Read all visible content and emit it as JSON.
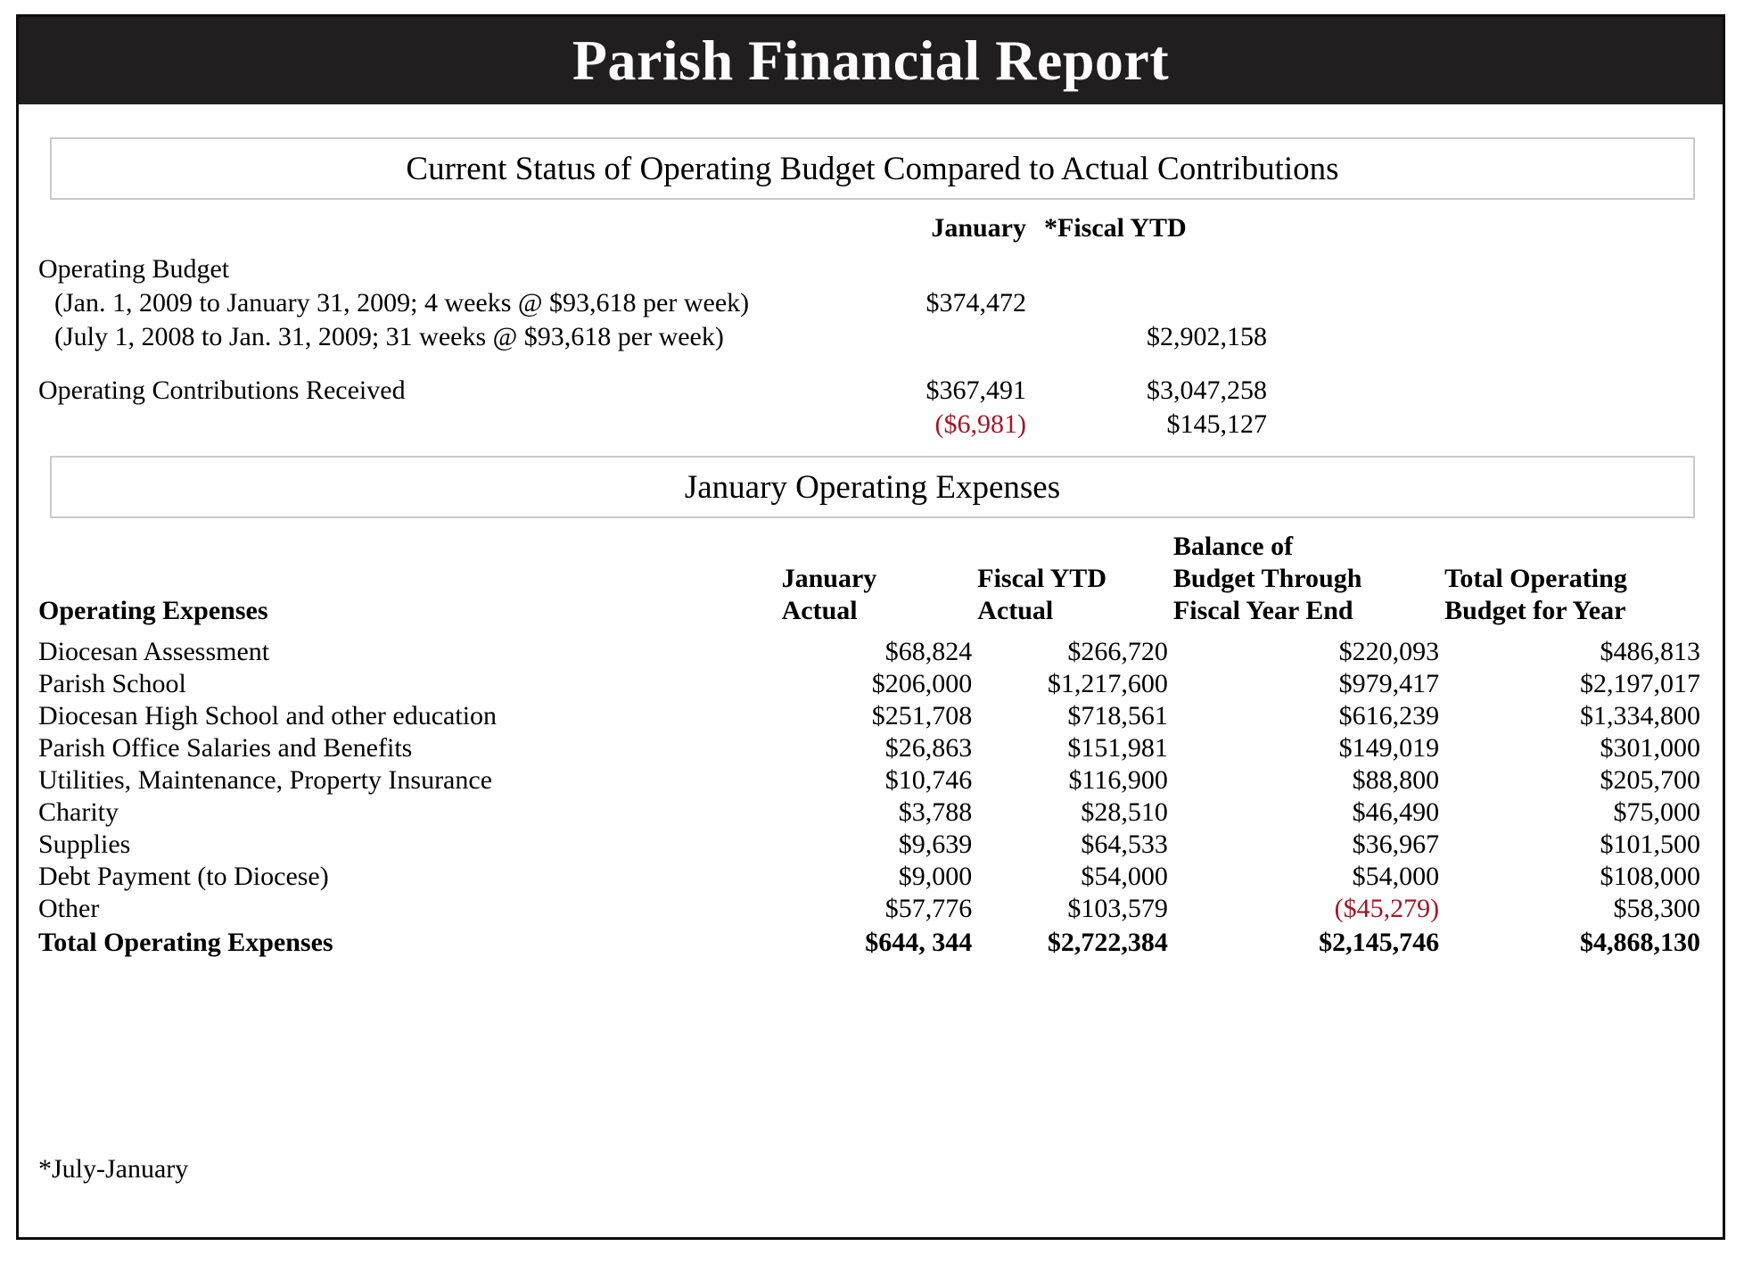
{
  "report": {
    "title": "Parish Financial Report",
    "footnote": "*July-January",
    "accent_dark": "#201e1e",
    "negative_color": "#A3162A",
    "section_border_color": "#c9c9c9"
  },
  "budget_section": {
    "heading": "Current Status of Operating Budget Compared to Actual Contributions",
    "column_headers": {
      "january": "January",
      "fiscal_ytd": "*Fiscal YTD"
    },
    "rows": [
      {
        "label": "Operating Budget",
        "january": "",
        "fiscal_ytd": "",
        "indent": false
      },
      {
        "label": "(Jan. 1, 2009 to January 31, 2009; 4 weeks @ $93,618 per week)",
        "january": "$374,472",
        "fiscal_ytd": "",
        "indent": true
      },
      {
        "label": "(July 1, 2008 to Jan. 31, 2009; 31 weeks @ $93,618 per week)",
        "january": "",
        "fiscal_ytd": "$2,902,158",
        "indent": true
      }
    ],
    "contributions": {
      "label": "Operating Contributions Received",
      "january": "$367,491",
      "fiscal_ytd": "$3,047,258"
    },
    "variance": {
      "january": "($6,981)",
      "january_negative": true,
      "fiscal_ytd": "$145,127",
      "fiscal_ytd_negative": false
    }
  },
  "expenses_section": {
    "heading": "January Operating Expenses",
    "columns": [
      {
        "line1": "",
        "line2": "",
        "line3": "Operating Expenses"
      },
      {
        "line1": "",
        "line2": "January",
        "line3": "Actual"
      },
      {
        "line1": "",
        "line2": "Fiscal YTD",
        "line3": "Actual"
      },
      {
        "line1": "Balance of",
        "line2": "Budget Through",
        "line3": "Fiscal Year End"
      },
      {
        "line1": "",
        "line2": "Total Operating",
        "line3": "Budget for Year"
      }
    ],
    "rows": [
      {
        "label": "Diocesan Assessment",
        "january_actual": "$68,824",
        "fiscal_ytd_actual": "$266,720",
        "balance_through_year_end": "$220,093",
        "total_budget_year": "$486,813",
        "balance_negative": false
      },
      {
        "label": "Parish School",
        "january_actual": "$206,000",
        "fiscal_ytd_actual": "$1,217,600",
        "balance_through_year_end": "$979,417",
        "total_budget_year": "$2,197,017",
        "balance_negative": false
      },
      {
        "label": "Diocesan High School and other education",
        "january_actual": "$251,708",
        "fiscal_ytd_actual": "$718,561",
        "balance_through_year_end": "$616,239",
        "total_budget_year": "$1,334,800",
        "balance_negative": false
      },
      {
        "label": "Parish Office Salaries and Benefits",
        "january_actual": "$26,863",
        "fiscal_ytd_actual": "$151,981",
        "balance_through_year_end": "$149,019",
        "total_budget_year": "$301,000",
        "balance_negative": false
      },
      {
        "label": "Utilities, Maintenance, Property Insurance",
        "january_actual": "$10,746",
        "fiscal_ytd_actual": "$116,900",
        "balance_through_year_end": "$88,800",
        "total_budget_year": "$205,700",
        "balance_negative": false
      },
      {
        "label": "Charity",
        "january_actual": "$3,788",
        "fiscal_ytd_actual": "$28,510",
        "balance_through_year_end": "$46,490",
        "total_budget_year": "$75,000",
        "balance_negative": false
      },
      {
        "label": "Supplies",
        "january_actual": "$9,639",
        "fiscal_ytd_actual": "$64,533",
        "balance_through_year_end": "$36,967",
        "total_budget_year": "$101,500",
        "balance_negative": false
      },
      {
        "label": "Debt Payment (to Diocese)",
        "january_actual": "$9,000",
        "fiscal_ytd_actual": "$54,000",
        "balance_through_year_end": "$54,000",
        "total_budget_year": "$108,000",
        "balance_negative": false
      },
      {
        "label": "Other",
        "january_actual": "$57,776",
        "fiscal_ytd_actual": "$103,579",
        "balance_through_year_end": "($45,279)",
        "total_budget_year": "$58,300",
        "balance_negative": true
      }
    ],
    "total_row": {
      "label": "Total Operating Expenses",
      "january_actual": "$644, 344",
      "fiscal_ytd_actual": "$2,722,384",
      "balance_through_year_end": "$2,145,746",
      "total_budget_year": "$4,868,130",
      "balance_negative": false
    }
  }
}
